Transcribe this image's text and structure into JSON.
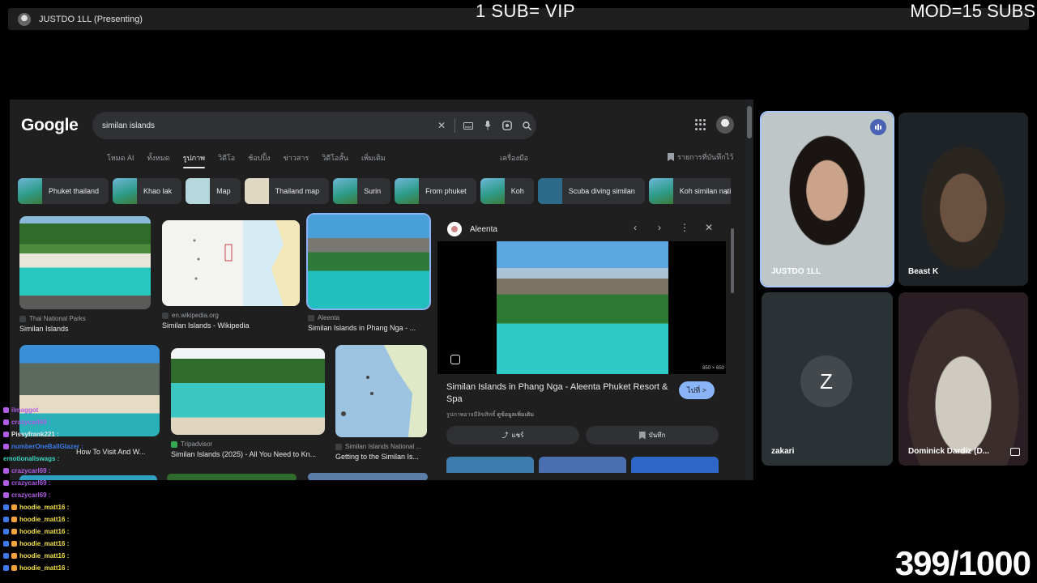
{
  "presenting": {
    "label": "JUSTDO 1LL (Presenting)"
  },
  "overlay": {
    "left_text": "1 SUB= VIP",
    "right_text": "MOD=15 SUBS",
    "counter": "399/1000"
  },
  "google": {
    "logo": "Google",
    "query": "similan islands",
    "tabs": [
      "โหมด AI",
      "ทั้งหมด",
      "รูปภาพ",
      "วิดีโอ",
      "ช้อปปิ้ง",
      "ข่าวสาร",
      "วิดีโอสั้น",
      "เพิ่มเติม"
    ],
    "tools": "เครื่องมือ",
    "saved": "รายการที่บันทึกไว้",
    "chips": [
      "Phuket thailand",
      "Khao lak",
      "Map",
      "Thailand map",
      "Surin",
      "From phuket",
      "Koh",
      "Scuba diving similan",
      "Koh similan nati"
    ],
    "results": [
      {
        "source": "Thai National Parks",
        "title": "Similan Islands"
      },
      {
        "source": "en.wikipedia.org",
        "title": "Similan Islands - Wikipedia"
      },
      {
        "source": "Aleenta",
        "title": "Similan Islands in Phang Nga - ..."
      },
      {
        "source": "",
        "title": "How To Visit And W..."
      },
      {
        "source": "Tripadvisor",
        "title": "Similan Islands (2025) - All You Need to Kn..."
      },
      {
        "source": "Similan Islands National ...",
        "title": "Getting to the Similan Is..."
      }
    ],
    "preview": {
      "site": "Aleenta",
      "dimensions": "850 × 650",
      "title": "Similan Islands in Phang Nga - Aleenta Phuket Resort & Spa",
      "visit": "ไปที่ >",
      "copyright": "รูปภาพอาจมีลิขสิทธิ์",
      "learn_more": "ดูข้อมูลเพิ่มเติม",
      "share": "แชร์",
      "save": "บันทึก"
    }
  },
  "participants": [
    {
      "name": "JUSTDO 1LL"
    },
    {
      "name": "Beast K"
    },
    {
      "name": "zakari",
      "initial": "Z"
    },
    {
      "name": "Dominick Dardiz (D..."
    }
  ],
  "chat": [
    {
      "user": "ilmaggot",
      "color": "#b05ce6"
    },
    {
      "user": "crazycarl69 :",
      "color": "#b05ce6"
    },
    {
      "user": "Pissyfrank221 :",
      "color": "#e6e6e6"
    },
    {
      "user": "numberOneBallGlazer :",
      "color": "#3e7be8"
    },
    {
      "user": "emotionallswags :",
      "color": "#3cd6c0"
    },
    {
      "user": "crazycarl69 :",
      "color": "#b05ce6"
    },
    {
      "user": "crazycarl69 :",
      "color": "#b05ce6"
    },
    {
      "user": "crazycarl69 :",
      "color": "#b05ce6"
    },
    {
      "user": "hoodie_matt16 :",
      "color": "#f2e04b"
    },
    {
      "user": "hoodie_matt16 :",
      "color": "#f2e04b"
    },
    {
      "user": "hoodie_matt16 :",
      "color": "#f2e04b"
    },
    {
      "user": "hoodie_matt16 :",
      "color": "#f2e04b"
    },
    {
      "user": "hoodie_matt16 :",
      "color": "#f2e04b"
    },
    {
      "user": "hoodie_matt16 :",
      "color": "#f2e04b"
    }
  ]
}
